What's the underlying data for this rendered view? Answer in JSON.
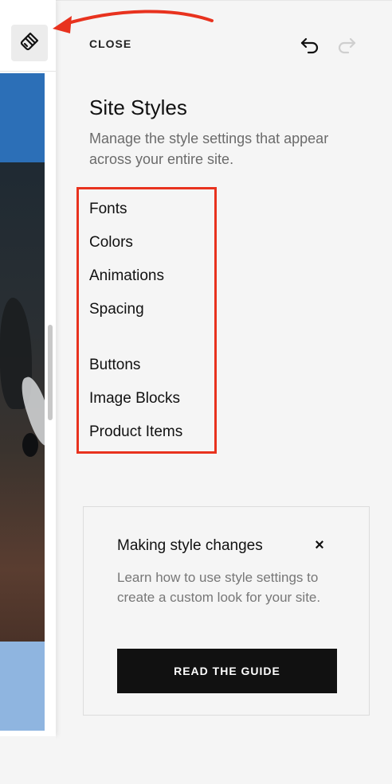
{
  "panel": {
    "close_label": "CLOSE",
    "title": "Site Styles",
    "subtitle": "Manage the style settings that appear across your entire site."
  },
  "menu": {
    "items": [
      {
        "label": "Fonts"
      },
      {
        "label": "Colors"
      },
      {
        "label": "Animations"
      },
      {
        "label": "Spacing"
      },
      {
        "label": "Buttons"
      },
      {
        "label": "Image Blocks"
      },
      {
        "label": "Product Items"
      }
    ]
  },
  "guide_card": {
    "title": "Making style changes",
    "close_symbol": "×",
    "body": "Learn how to use style settings to create a custom look for your site.",
    "button_label": "READ THE GUIDE"
  },
  "icons": {
    "style_button": "paintbrush-icon",
    "undo": "undo-icon",
    "redo": "redo-icon",
    "card_close": "close-icon"
  },
  "colors": {
    "annotation_red": "#e8321e",
    "button_black": "#111111",
    "header_blue": "#2c6fb7",
    "footer_light_blue": "#8fb5e0"
  }
}
